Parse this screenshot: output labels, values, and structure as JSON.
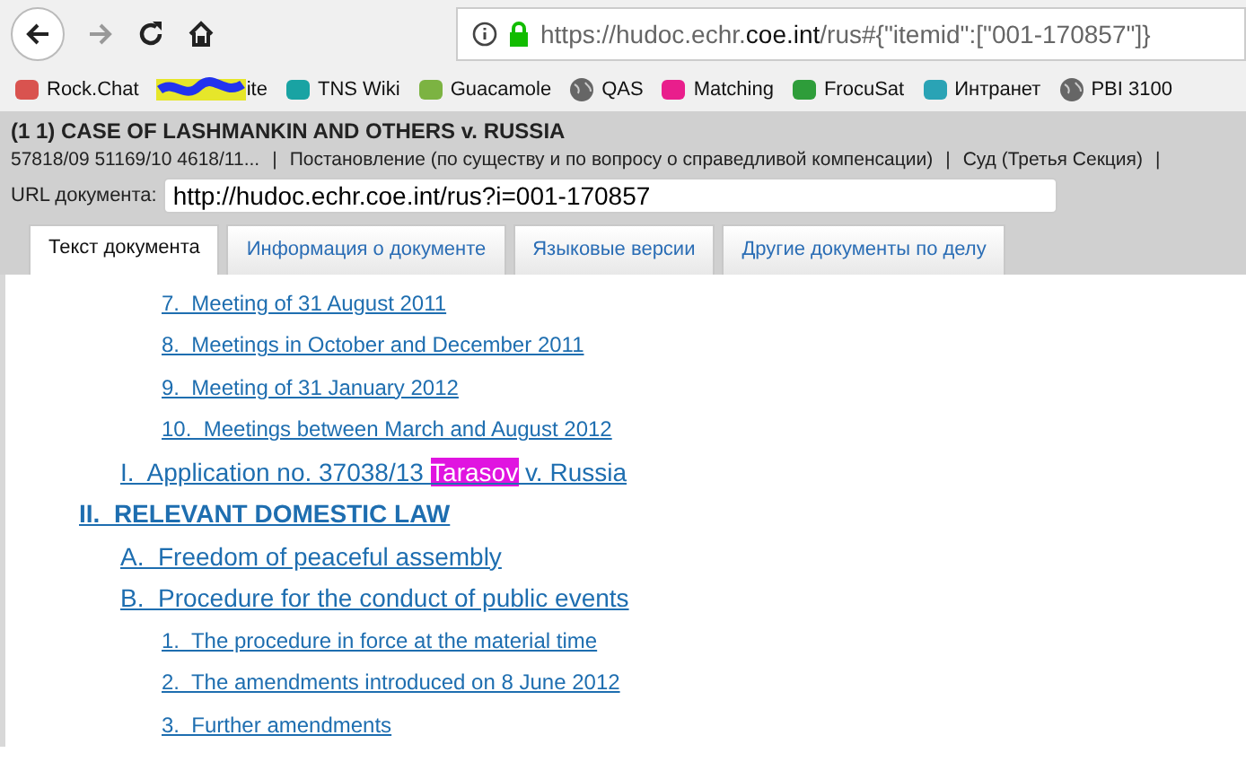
{
  "browser": {
    "url": {
      "prefix": "https://hudoc.echr.",
      "domain": "coe.int",
      "suffix": "/rus#{\"itemid\":[\"001-170857\"]}"
    }
  },
  "bookmarks": [
    {
      "label": "Rock.Chat",
      "kind": "chat"
    },
    {
      "label": "ite",
      "kind": "redacted"
    },
    {
      "label": "TNS Wiki",
      "kind": "wiki"
    },
    {
      "label": "Guacamole",
      "kind": "bowl"
    },
    {
      "label": "QAS",
      "kind": "globe"
    },
    {
      "label": "Matching",
      "kind": "tns"
    },
    {
      "label": "FrocuSat",
      "kind": "ring"
    },
    {
      "label": "Интранет",
      "kind": "house"
    },
    {
      "label": "PBI 3100",
      "kind": "globe"
    }
  ],
  "document": {
    "title": "(1 1) CASE OF LASHMANKIN AND OTHERS v. RUSSIA",
    "meta": [
      "57818/09 51169/10 4618/11...",
      "|",
      "Постановление (по существу и по вопросу о справедливой компенсации)",
      "|",
      "Суд (Третья Секция)",
      "|"
    ],
    "url_label": "URL документа:",
    "url_value": "http://hudoc.echr.coe.int/rus?i=001-170857"
  },
  "tabs": [
    {
      "label": "Текст документа",
      "selected": true
    },
    {
      "label": "Информация о документе",
      "selected": false
    },
    {
      "label": "Языковые версии",
      "selected": false
    },
    {
      "label": "Другие документы по делу",
      "selected": false
    }
  ],
  "toc": [
    {
      "children": [
        {
          "children": [
            {
              "parts": [
                {
                  "text": "7.  Meeting of 31 August 2011",
                  "highlighted": false
                }
              ]
            },
            {
              "parts": [
                {
                  "text": "8.  Meetings in October and December 2011",
                  "highlighted": false
                }
              ]
            },
            {
              "parts": [
                {
                  "text": "9.  Meeting of 31 January 2012",
                  "highlighted": false
                }
              ]
            },
            {
              "parts": [
                {
                  "text": "10.  Meetings between March and August 2012",
                  "highlighted": false
                }
              ]
            }
          ]
        },
        {
          "parts": [
            {
              "text": "I.  Application no. 37038/13 ",
              "highlighted": false
            },
            {
              "text": "Tarasov",
              "highlighted": true
            },
            {
              "text": " v. Russia",
              "highlighted": false
            }
          ]
        }
      ]
    },
    {
      "parts": [
        {
          "text": "II.  RELEVANT DOMESTIC LAW",
          "highlighted": false
        }
      ],
      "bold": true,
      "children": [
        {
          "parts": [
            {
              "text": "A.  Freedom of peaceful assembly",
              "highlighted": false
            }
          ]
        },
        {
          "parts": [
            {
              "text": "B.  Procedure for the conduct of public events",
              "highlighted": false
            }
          ],
          "children": [
            {
              "parts": [
                {
                  "text": "1.  The procedure in force at the material time",
                  "highlighted": false
                }
              ]
            },
            {
              "parts": [
                {
                  "text": "2.  The amendments introduced on 8 June 2012",
                  "highlighted": false
                }
              ]
            },
            {
              "parts": [
                {
                  "text": "3.  Further amendments",
                  "highlighted": false
                }
              ]
            }
          ]
        }
      ]
    }
  ]
}
